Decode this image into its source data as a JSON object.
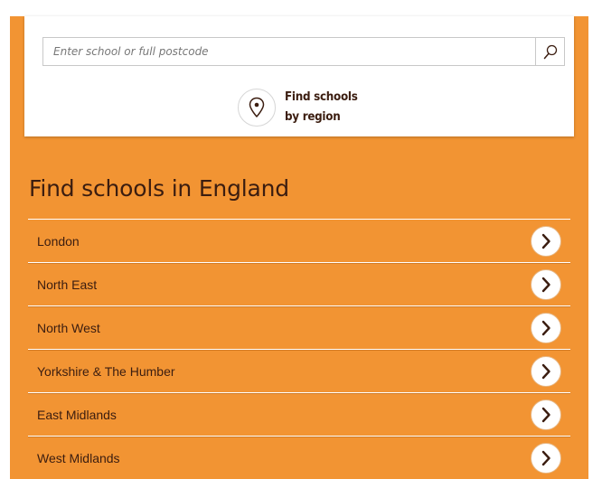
{
  "search": {
    "placeholder": "Enter school or full postcode",
    "value": ""
  },
  "region_link": {
    "line1": "Find schools",
    "line2": "by region"
  },
  "section": {
    "title": "Find schools in England"
  },
  "regions": [
    {
      "label": "London"
    },
    {
      "label": "North East"
    },
    {
      "label": "North West"
    },
    {
      "label": "Yorkshire & The Humber"
    },
    {
      "label": "East Midlands"
    },
    {
      "label": "West Midlands"
    }
  ],
  "icons": {
    "search": "search-icon",
    "pin": "map-pin-icon",
    "chevron": "chevron-right-icon"
  },
  "colors": {
    "accent": "#f29433",
    "text_dark": "#3b1d10",
    "card": "#ffffff"
  }
}
